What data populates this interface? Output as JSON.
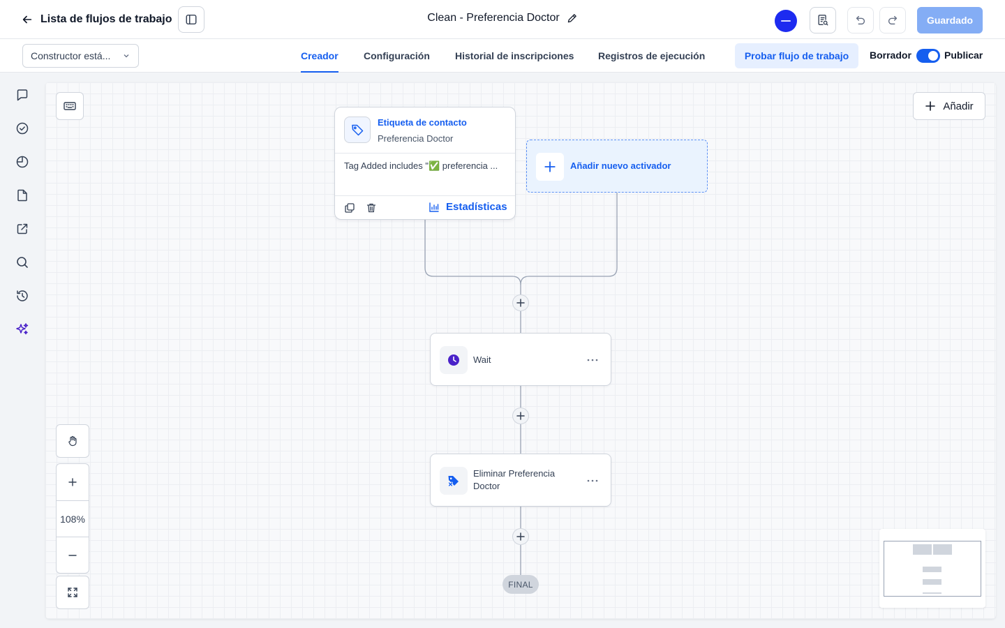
{
  "header": {
    "back_label": "Lista de flujos de trabajo",
    "workflow_title": "Clean - Preferencia Doctor",
    "save_label": "Guardado"
  },
  "subbar": {
    "builder_select": "Constructor está...",
    "tabs": [
      {
        "label": "Creador",
        "active": true
      },
      {
        "label": "Configuración",
        "active": false
      },
      {
        "label": "Historial de inscripciones",
        "active": false
      },
      {
        "label": "Registros de ejecución",
        "active": false
      }
    ],
    "test_label": "Probar flujo de trabajo",
    "draft_label": "Borrador",
    "publish_label": "Publicar",
    "published": true
  },
  "sidebar": {
    "icons": [
      "chat-icon",
      "check-circle-icon",
      "pie-chart-icon",
      "document-icon",
      "external-link-icon",
      "search-icon",
      "history-icon",
      "sparkle-icon"
    ]
  },
  "canvas": {
    "add_label": "Añadir",
    "trigger": {
      "type_label": "Etiqueta de contacto",
      "name": "Preferencia Doctor",
      "condition": "Tag Added includes \"✅ preferencia ...",
      "stats_label": "Estadísticas"
    },
    "new_trigger_label": "Añadir nuevo activador",
    "actions": [
      {
        "label": "Wait",
        "icon": "clock-icon"
      },
      {
        "label": "Eliminar Preferencia Doctor",
        "icon": "tag-remove-icon"
      }
    ],
    "final_label": "FINAL",
    "zoom_level": "108%"
  },
  "colors": {
    "accent": "#155eef",
    "save_disabled": "#84adf5",
    "wait_icon": "#4a22c9"
  }
}
